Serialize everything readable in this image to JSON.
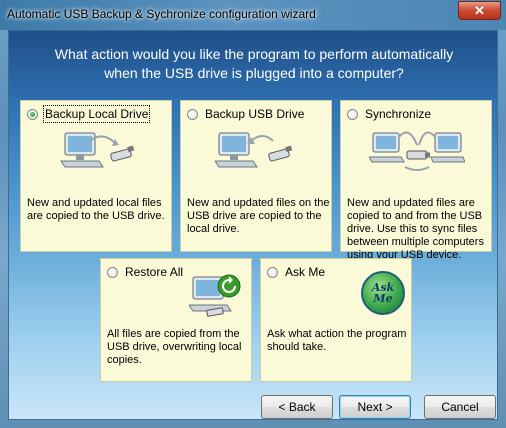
{
  "window": {
    "title": "Automatic USB Backup & Sychronize configuration wizard",
    "close_glyph": "✕"
  },
  "question": {
    "line1": "What action would you like the program to perform automatically",
    "line2": "when the USB drive is plugged into a computer?"
  },
  "options": [
    {
      "label": "Backup Local Drive",
      "selected": true,
      "desc": [
        "New and updated local files",
        "are copied to the USB drive."
      ],
      "icon": "computer-to-usb-icon"
    },
    {
      "label": "Backup USB Drive",
      "selected": false,
      "desc": [
        "New and updated files on the",
        "USB drive are copied to the",
        "local drive."
      ],
      "icon": "usb-to-computer-icon"
    },
    {
      "label": "Synchronize",
      "selected": false,
      "desc": [
        "New and updated files are",
        "copied to and from the USB",
        "drive. Use this to sync files",
        "between multiple computers",
        "using your USB device."
      ],
      "icon": "sync-computers-icon"
    },
    {
      "label": "Restore All",
      "selected": false,
      "desc": [
        "All files are copied from the",
        "USB drive, overwriting local",
        "copies."
      ],
      "icon": "restore-icon"
    },
    {
      "label": "Ask Me",
      "selected": false,
      "desc": [
        "Ask what action the program",
        "should take."
      ],
      "icon": "ask-me-badge-icon",
      "badge_text": "Ask Me"
    }
  ],
  "buttons": {
    "back": "< Back",
    "next": "Next >",
    "cancel": "Cancel"
  },
  "colors": {
    "card_bg": "#fafad9",
    "accent_blue": "#2e6fb0",
    "restore_green": "#3a9a2a"
  }
}
